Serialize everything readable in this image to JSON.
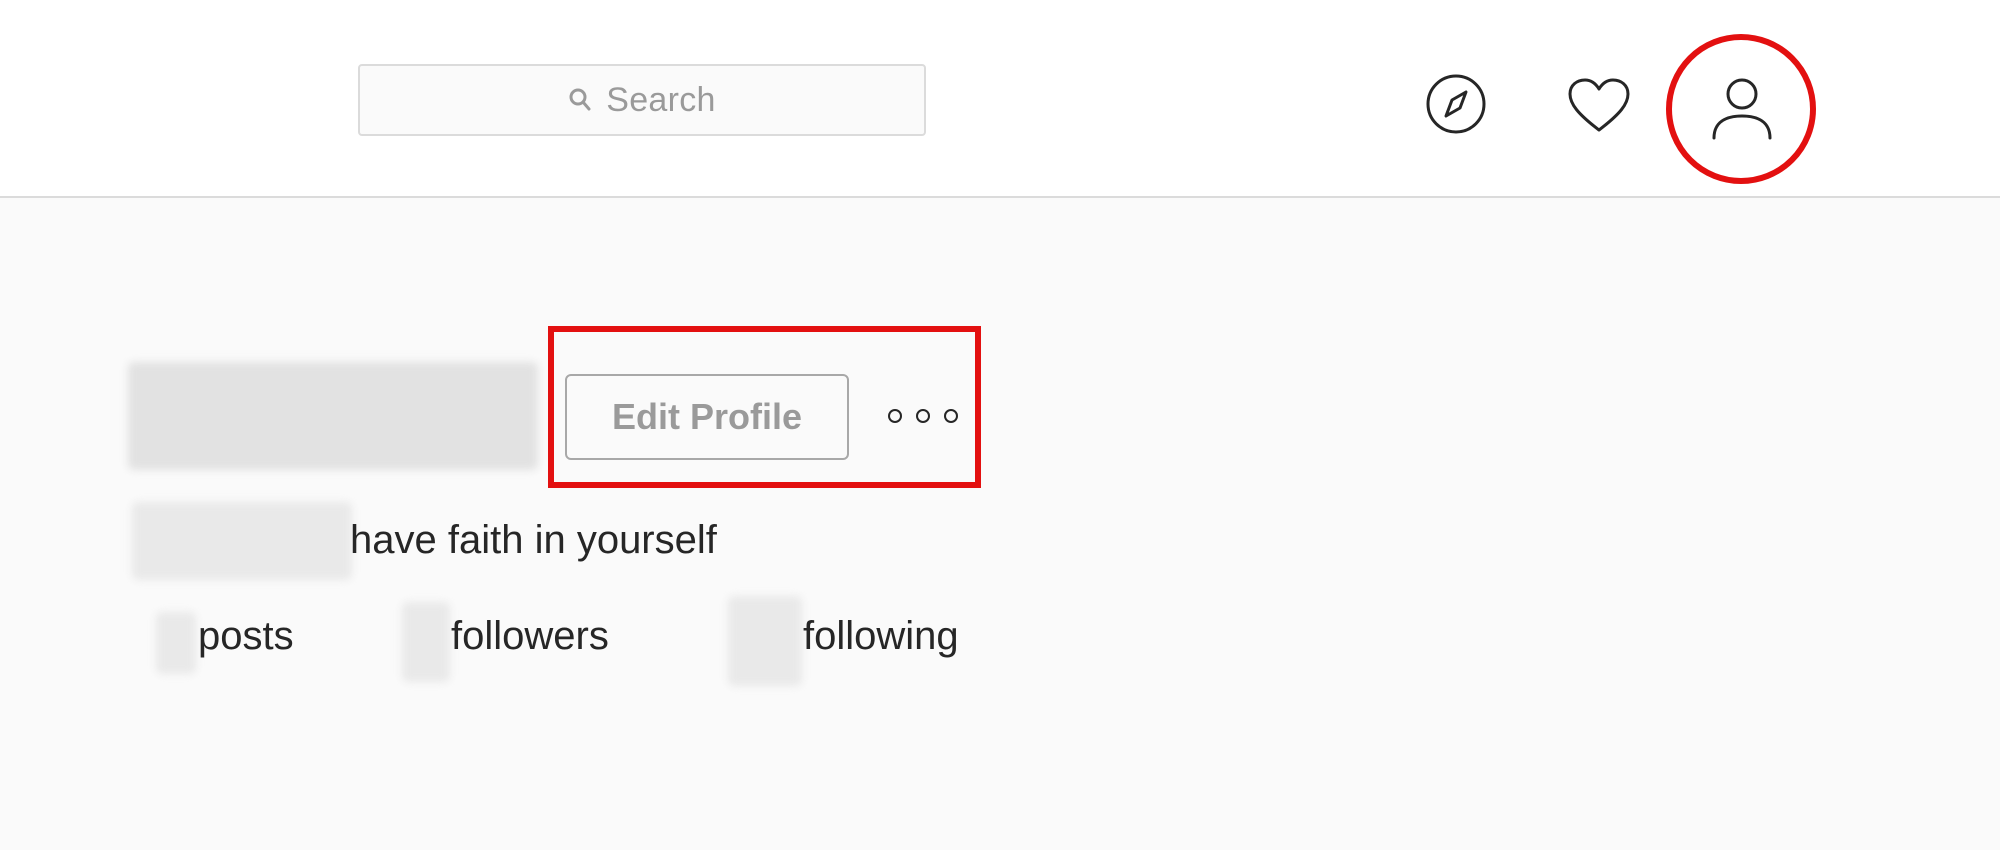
{
  "header": {
    "search": {
      "placeholder": "Search",
      "icon": "search-icon"
    },
    "nav": [
      {
        "name": "explore",
        "icon": "compass-icon"
      },
      {
        "name": "activity",
        "icon": "heart-icon"
      },
      {
        "name": "profile",
        "icon": "profile-icon"
      }
    ]
  },
  "profile": {
    "edit_button_label": "Edit Profile",
    "more_options_icon": "more-options-icon",
    "bio": "have faith in yourself",
    "stats": {
      "posts_label": "posts",
      "followers_label": "followers",
      "following_label": "following"
    }
  },
  "annotations": {
    "highlight_color": "#e31010"
  }
}
